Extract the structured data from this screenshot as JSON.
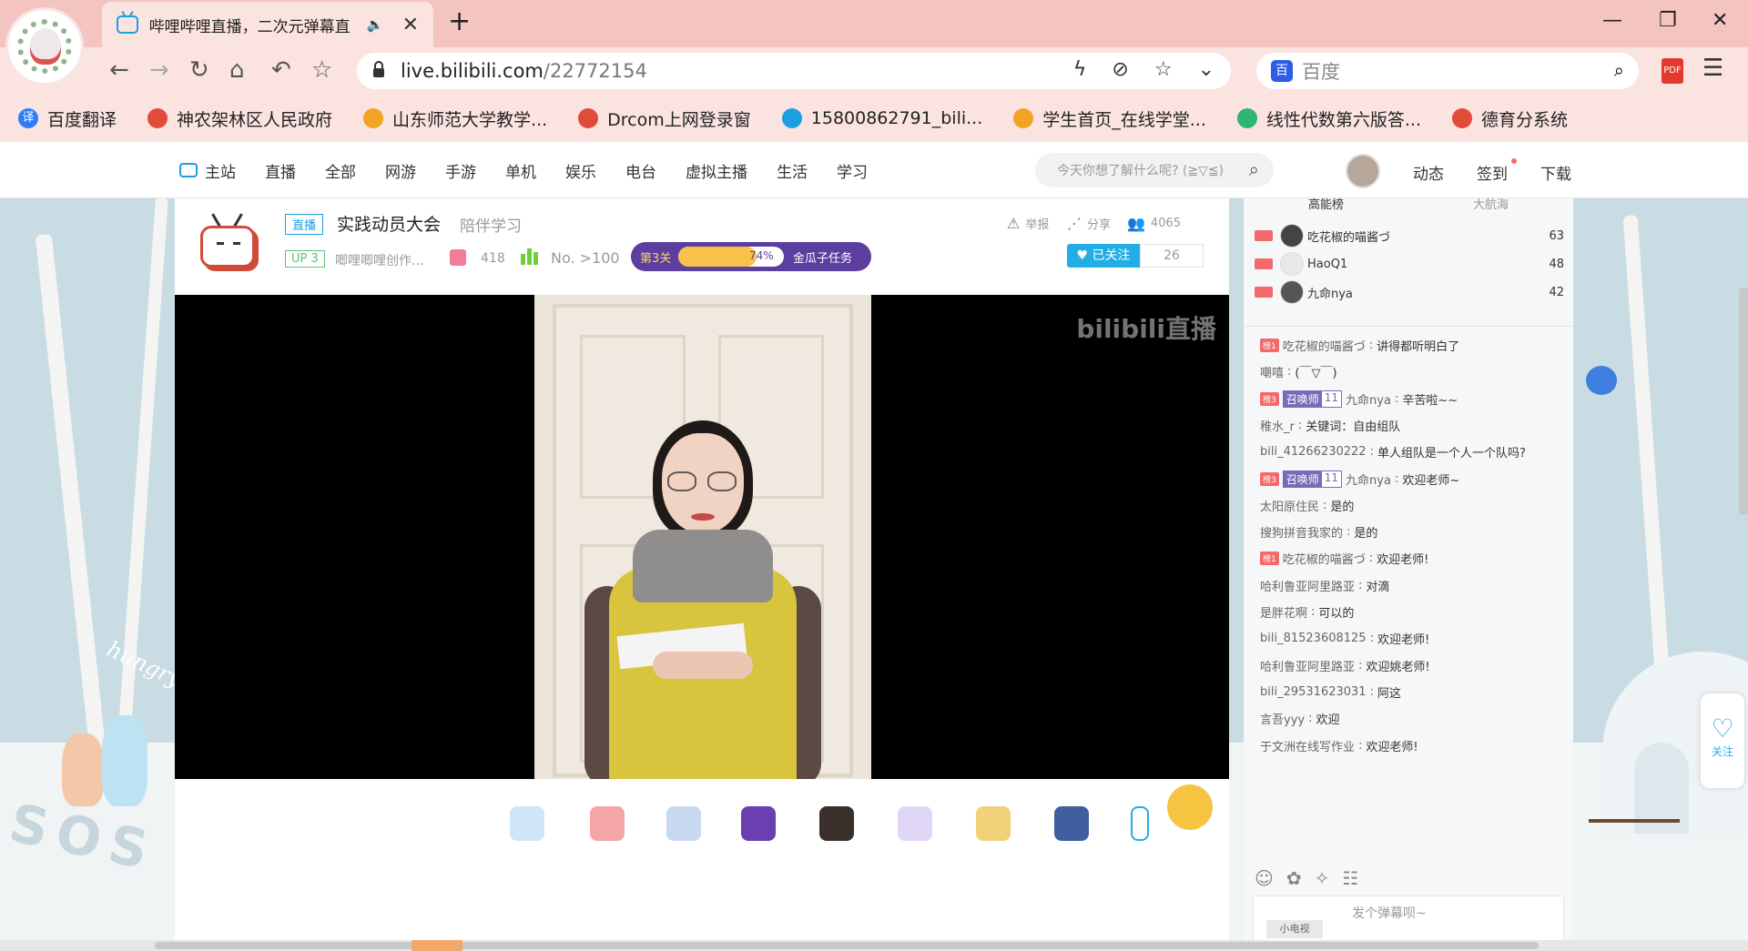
{
  "browser": {
    "tab_title": "哔哩哔哩直播，二次元弹幕直",
    "tab_audio_icon": "speaker-icon",
    "url_host": "live.bilibili.com",
    "url_path": "/22772154",
    "search_placeholder": "百度",
    "search_logo": "百",
    "pdf_label": "PDF",
    "window_controls": [
      "minimize-icon",
      "restore-icon",
      "close-icon"
    ]
  },
  "bookmarks": [
    {
      "label": "百度翻译",
      "icon": "译",
      "color": "#2f7cf6"
    },
    {
      "label": "神农架林区人民政府",
      "icon": "",
      "color": "#e24a3b"
    },
    {
      "label": "山东师范大学教学...",
      "icon": "",
      "color": "#f1a323"
    },
    {
      "label": "Drcom上网登录窗",
      "icon": "",
      "color": "#e24a3b"
    },
    {
      "label": "15800862791_bili...",
      "icon": "",
      "color": "#1aa0e0"
    },
    {
      "label": "学生首页_在线学堂...",
      "icon": "",
      "color": "#f1a323"
    },
    {
      "label": "线性代数第六版答...",
      "icon": "",
      "color": "#2bb673"
    },
    {
      "label": "德育分系统",
      "icon": "",
      "color": "#e24a3b"
    }
  ],
  "site_nav": {
    "home": "主站",
    "items": [
      "直播",
      "全部",
      "网游",
      "手游",
      "单机",
      "娱乐",
      "电台",
      "虚拟主播",
      "生活",
      "学习"
    ],
    "search_placeholder": "今天你想了解什么呢? (≧▽≦)",
    "dynamic": "动态",
    "sign": "签到",
    "download": "下载"
  },
  "room": {
    "live_badge": "直播",
    "title": "实践动员大会",
    "tag": "陪伴学习",
    "up_level": "UP 3",
    "up_name": "唧哩唧哩创作...",
    "gift_count": "418",
    "rank": "No. >100",
    "task_level": "第3关",
    "task_percent": "74%",
    "task_progress": 0.74,
    "task_name": "金瓜子任务",
    "report": "举报",
    "share": "分享",
    "viewers": "4065",
    "follow_label": "已关注",
    "follow_count": "26",
    "watermark": "bilibili直播"
  },
  "rank_tabs": [
    "高能榜",
    "大航海"
  ],
  "rank_list": [
    {
      "name": "吃花椒的喵酱づ",
      "score": "63",
      "avatar_color": "#444"
    },
    {
      "name": "HaoQ1",
      "score": "48",
      "avatar_color": "#e9e9ec"
    },
    {
      "name": "九命nya",
      "score": "42",
      "avatar_color": "#555"
    }
  ],
  "danmaku": [
    {
      "medal": "榜1",
      "title": "",
      "level": "",
      "user": "吃花椒的喵酱づ",
      "text": "讲得都听明白了"
    },
    {
      "medal": "",
      "title": "",
      "level": "",
      "user": "嘲嘻",
      "text": "(￣▽￣)"
    },
    {
      "medal": "榜3",
      "title": "召唤师",
      "level": "11",
      "user": "九命nya",
      "text": "辛苦啦~~"
    },
    {
      "medal": "",
      "title": "",
      "level": "",
      "user": "稚水_r",
      "text": "关键词：自由组队"
    },
    {
      "medal": "",
      "title": "",
      "level": "",
      "user": "bili_41266230222",
      "text": "单人组队是一个人一个队吗?"
    },
    {
      "medal": "榜3",
      "title": "召唤师",
      "level": "11",
      "user": "九命nya",
      "text": "欢迎老师~"
    },
    {
      "medal": "",
      "title": "",
      "level": "",
      "user": "太阳原住民",
      "text": "是的"
    },
    {
      "medal": "",
      "title": "",
      "level": "",
      "user": "搜狗拼音我家的",
      "text": "是的"
    },
    {
      "medal": "榜1",
      "title": "",
      "level": "",
      "user": "吃花椒的喵酱づ",
      "text": "欢迎老师!"
    },
    {
      "medal": "",
      "title": "",
      "level": "",
      "user": "哈利鲁亚阿里路亚",
      "text": "对滴"
    },
    {
      "medal": "",
      "title": "",
      "level": "",
      "user": "是胖花啊",
      "text": "可以的"
    },
    {
      "medal": "",
      "title": "",
      "level": "",
      "user": "bili_81523608125",
      "text": "欢迎老师!"
    },
    {
      "medal": "",
      "title": "",
      "level": "",
      "user": "哈利鲁亚阿里路亚",
      "text": "欢迎姚老师!"
    },
    {
      "medal": "",
      "title": "",
      "level": "",
      "user": "bili_29531623031",
      "text": "阿这"
    },
    {
      "medal": "",
      "title": "",
      "level": "",
      "user": "言吾yyy",
      "text": "欢迎"
    },
    {
      "medal": "",
      "title": "",
      "level": "",
      "user": "于文洲在线写作业",
      "text": "欢迎老师!"
    }
  ],
  "danmaku_input": {
    "placeholder": "发个弹幕呗~",
    "mode": "小电视"
  },
  "float_follow": "关注",
  "decor": {
    "sos": "SOS",
    "hungry": "hungry"
  }
}
